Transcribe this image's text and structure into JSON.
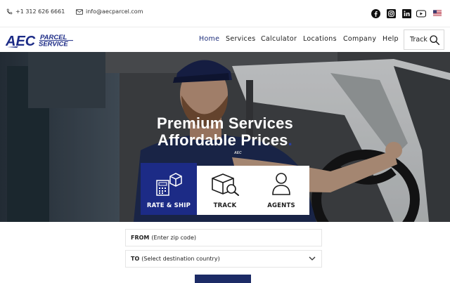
{
  "topbar": {
    "phone": "+1 312 626 6661",
    "email": "info@aecparcel.com",
    "social_icons": [
      "facebook-icon",
      "instagram-icon",
      "linkedin-icon",
      "youtube-icon"
    ],
    "language_flag": "us-flag-icon"
  },
  "brand": {
    "line1": "AEC",
    "line2": "PARCEL",
    "line3": "SERVICE",
    "color": "#1c2b86"
  },
  "nav": {
    "items": [
      "Home",
      "Services",
      "Calculator",
      "Locations",
      "Company",
      "Help"
    ],
    "active": "Home",
    "track_label": "Track"
  },
  "hero": {
    "line1": "Premium Services",
    "line2": "Affordable Prices",
    "dot": ".",
    "shirt_logo": "AEC"
  },
  "service_cards": [
    {
      "label": "RATE & SHIP",
      "icon": "calculator-box-icon",
      "active": true
    },
    {
      "label": "TRACK",
      "icon": "box-search-icon",
      "active": false
    },
    {
      "label": "AGENTS",
      "icon": "agent-person-icon",
      "active": false
    }
  ],
  "form": {
    "from_label": "FROM",
    "from_placeholder": "(Enter zip code)",
    "to_label": "TO",
    "to_placeholder": "(Select destination country)"
  },
  "colors": {
    "accent": "#1c2b86",
    "submit": "#1c2b66"
  }
}
